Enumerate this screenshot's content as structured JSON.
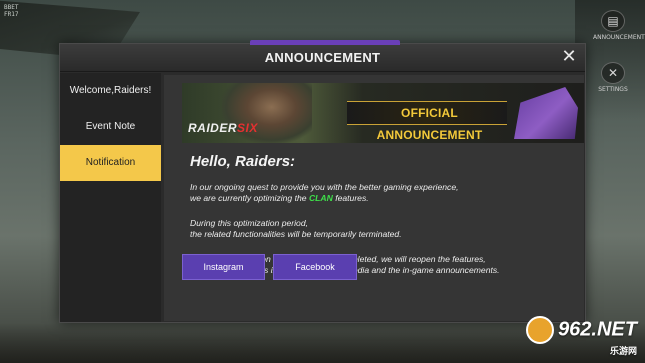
{
  "background": {
    "corner_tag_lines": [
      "BBET",
      "FR17"
    ],
    "side_buttons": [
      {
        "icon": "chat-icon",
        "label": "ANNOUNCEMENT"
      },
      {
        "icon": "crossed-tools-icon",
        "label": "SETTINGS"
      }
    ]
  },
  "dialog": {
    "title": "ANNOUNCEMENT",
    "close_glyph": "✕",
    "accent_color": "#6a3fb8"
  },
  "sidebar": {
    "tabs": [
      {
        "label": "Welcome,Raiders!",
        "active": false
      },
      {
        "label": "Event Note",
        "active": false
      },
      {
        "label": "Notification",
        "active": true
      }
    ],
    "active_color": "#f4c84a"
  },
  "content": {
    "banner": {
      "logo_part1": "RAIDER",
      "logo_part2": "SIX",
      "headline": "OFFICIAL ANNOUNCEMENT"
    },
    "greeting": "Hello, Raiders:",
    "paragraph1": {
      "line1": "In our ongoing quest to provide you with the better gaming experience,",
      "line2_before": "we are currently optimizing the ",
      "line2_highlight": "CLAN",
      "line2_after": " features."
    },
    "paragraph2": {
      "line1": "During this optimization period,",
      "line2": "the related functionalities will be temporarily terminated."
    },
    "paragraph3": {
      "line1": "After the optimization adjustments are completed, we will reopen the features,",
      "line2": "and notify all players in our official social media and the in-game announcements."
    },
    "highlight_color": "#3ee04a"
  },
  "buttons": {
    "instagram": "Instagram",
    "facebook": "Facebook",
    "color": "#5a3fb0"
  },
  "watermark": {
    "text": "962.NET",
    "subtext": "乐游网"
  }
}
